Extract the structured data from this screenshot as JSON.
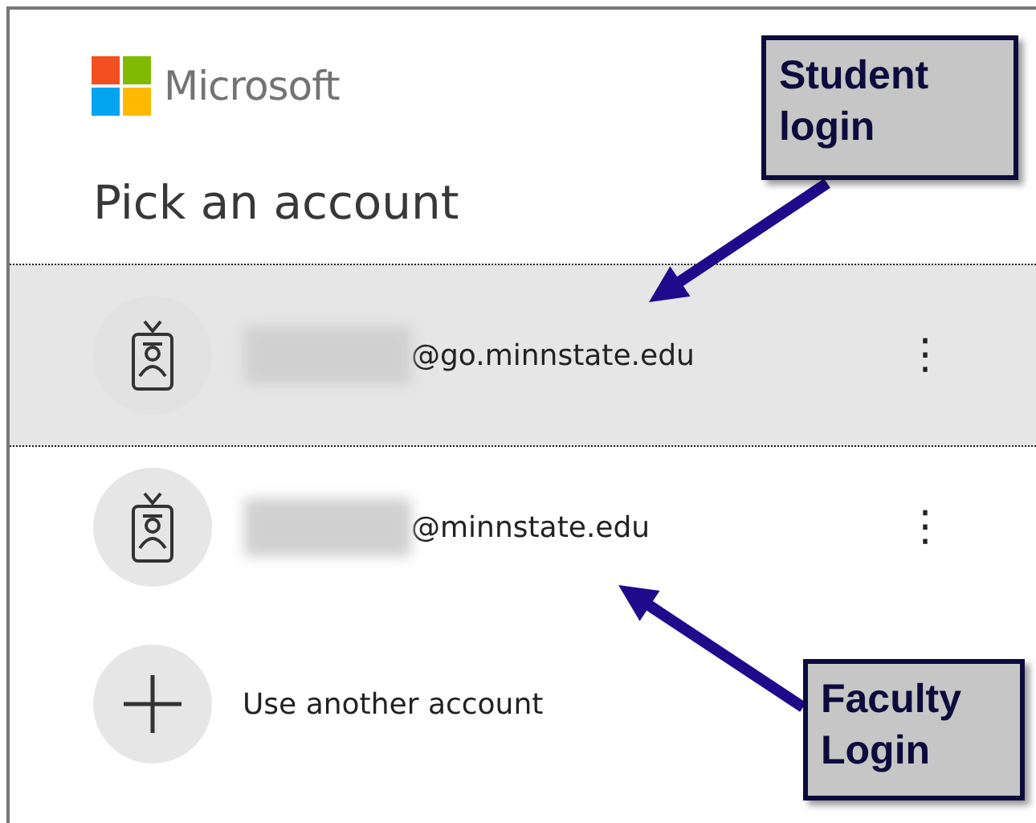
{
  "brand": {
    "name": "Microsoft"
  },
  "title": "Pick an account",
  "accounts": [
    {
      "kind": "account",
      "name_hidden": true,
      "email": "@go.minnstate.edu",
      "selected": true,
      "menu": "⋮"
    },
    {
      "kind": "account",
      "name_hidden": true,
      "email": "@minnstate.edu",
      "selected": false,
      "menu": "⋮"
    },
    {
      "kind": "add",
      "label": "Use another account",
      "selected": false
    }
  ],
  "callouts": [
    {
      "text": "Student login"
    },
    {
      "text": "Faculty Login"
    }
  ]
}
